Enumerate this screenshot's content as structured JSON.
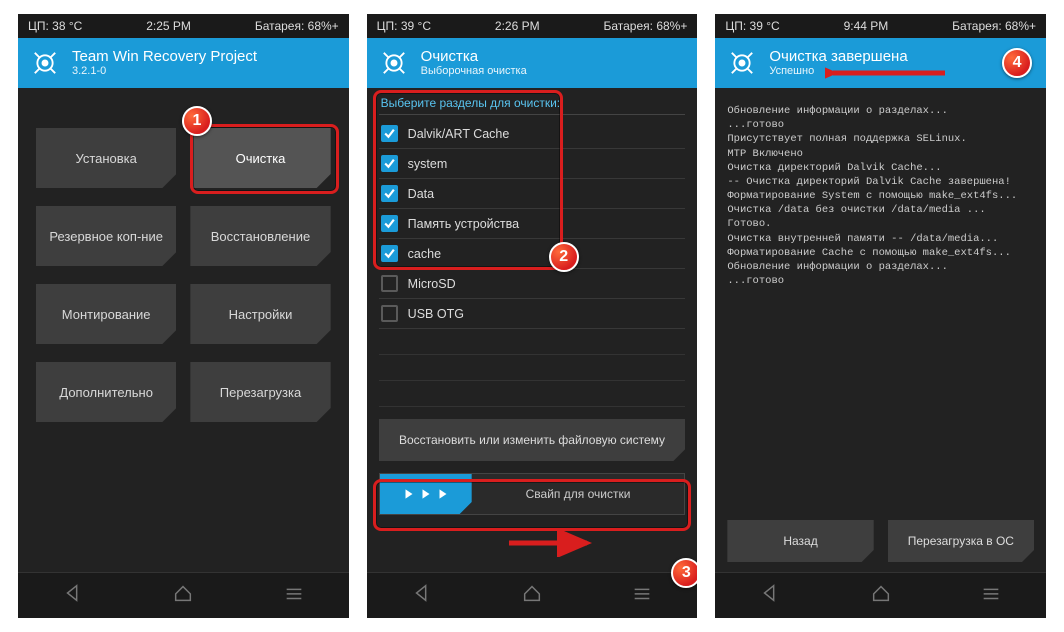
{
  "screens": [
    {
      "status": {
        "cpu": "ЦП: 38 °C",
        "time": "2:25 PM",
        "battery": "Батарея: 68%+"
      },
      "header": {
        "title": "Team Win Recovery Project",
        "sub": "3.2.1-0"
      },
      "tiles": [
        "Установка",
        "Очистка",
        "Резервное коп-ние",
        "Восстановление",
        "Монтирование",
        "Настройки",
        "Дополнительно",
        "Перезагрузка"
      ],
      "callout": 1
    },
    {
      "status": {
        "cpu": "ЦП: 39 °C",
        "time": "2:26 PM",
        "battery": "Батарея: 68%+"
      },
      "header": {
        "title": "Очистка",
        "sub": "Выборочная очистка"
      },
      "section_label": "Выберите разделы для очистки:",
      "items": [
        {
          "label": "Dalvik/ART Cache",
          "checked": true
        },
        {
          "label": "system",
          "checked": true
        },
        {
          "label": "Data",
          "checked": true
        },
        {
          "label": "Память устройства",
          "checked": true
        },
        {
          "label": "cache",
          "checked": true
        },
        {
          "label": "MicroSD",
          "checked": false
        },
        {
          "label": "USB OTG",
          "checked": false
        }
      ],
      "restore_btn": "Восстановить или изменить файловую систему",
      "swipe_label": "Свайп для очистки",
      "callout_list": 2,
      "callout_swipe": 3
    },
    {
      "status": {
        "cpu": "ЦП: 39 °C",
        "time": "9:44 PM",
        "battery": "Батарея: 68%+"
      },
      "header": {
        "title": "Очистка завершена",
        "sub": "Успешно"
      },
      "log_lines": [
        "Обновление информации о разделах...",
        "...готово",
        "Присутствует полная поддержка SELinux.",
        "MTP Включено",
        "Очистка директорий Dalvik Cache...",
        "-- Очистка директорий Dalvik Cache завершена!",
        "Форматирование System с помощью make_ext4fs...",
        "Очистка /data без очистки /data/media ...",
        "Готово.",
        "Очистка внутренней памяти -- /data/media...",
        "Форматирование Cache с помощью make_ext4fs...",
        "Обновление информации о разделах...",
        "...готово"
      ],
      "back_btn": "Назад",
      "reboot_btn": "Перезагрузка в ОС",
      "callout": 4
    }
  ]
}
